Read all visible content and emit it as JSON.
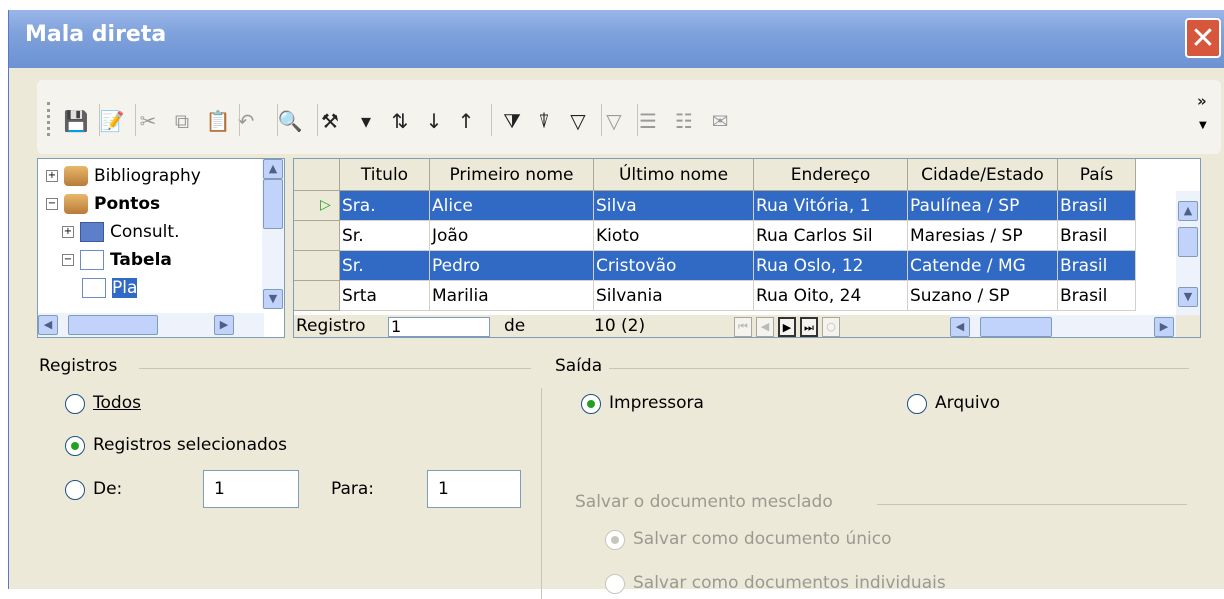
{
  "window": {
    "title": "Mala direta",
    "close_label": "✕"
  },
  "toolbar": {
    "buttons": [
      {
        "name": "save-icon",
        "glyph": "💾",
        "active": false
      },
      {
        "name": "edit-icon",
        "glyph": "📝",
        "active": false
      },
      {
        "name": "cut-icon",
        "glyph": "✂",
        "active": false
      },
      {
        "name": "copy-icon",
        "glyph": "⧉",
        "active": false
      },
      {
        "name": "paste-icon",
        "glyph": "📋",
        "active": false
      },
      {
        "name": "undo-icon",
        "glyph": "↶",
        "active": false
      },
      {
        "name": "find-icon",
        "glyph": "🔍",
        "active": true
      },
      {
        "name": "autopilot-icon",
        "glyph": "⚒",
        "active": true
      },
      {
        "name": "dropdown-arrow-icon",
        "glyph": "▾",
        "active": true
      },
      {
        "name": "sort-icon",
        "glyph": "⇅",
        "active": true
      },
      {
        "name": "sort-ascending-icon",
        "glyph": "↓",
        "active": true
      },
      {
        "name": "sort-descending-icon",
        "glyph": "↑",
        "active": true
      },
      {
        "name": "autofilter-icon",
        "glyph": "⧩",
        "active": true
      },
      {
        "name": "standard-filter-icon",
        "glyph": "⍒",
        "active": true
      },
      {
        "name": "remove-filter-icon",
        "glyph": "▽",
        "active": true
      },
      {
        "name": "data-to-text-icon",
        "glyph": "▽",
        "active": false
      },
      {
        "name": "data-to-fields-icon",
        "glyph": "☰",
        "active": false
      },
      {
        "name": "mail-merge-icon",
        "glyph": "☷",
        "active": false
      },
      {
        "name": "envelope-icon",
        "glyph": "✉",
        "active": false
      }
    ],
    "more_label": "»"
  },
  "tree": {
    "items": [
      {
        "label": "Bibliography",
        "expander": "+",
        "type": "db",
        "bold": false
      },
      {
        "label": "Pontos",
        "expander": "−",
        "type": "db",
        "bold": true
      },
      {
        "label": "Consult.",
        "expander": "+",
        "type": "query",
        "bold": false
      },
      {
        "label": "Tabela",
        "expander": "−",
        "type": "table",
        "bold": true
      },
      {
        "label": "Pla",
        "expander": "",
        "type": "table",
        "bold": false
      }
    ]
  },
  "grid": {
    "columns": [
      "Titulo",
      "Primeiro nome",
      "Último nome",
      "Endereço",
      "Cidade/Estado",
      "País"
    ],
    "rows": [
      {
        "cells": [
          "Sra.",
          "Alice",
          "Silva",
          "Rua Vitória, 1",
          "Paulínea / SP",
          "Brasil"
        ],
        "selected": true,
        "current": true
      },
      {
        "cells": [
          "Sr.",
          "João",
          "Kioto",
          "Rua Carlos Sil",
          "Maresias / SP",
          "Brasil"
        ],
        "selected": false,
        "current": false
      },
      {
        "cells": [
          "Sr.",
          "Pedro",
          "Cristovão",
          "Rua Oslo, 12",
          "Catende / MG",
          "Brasil"
        ],
        "selected": true,
        "current": false
      },
      {
        "cells": [
          "Srta",
          "Marilia",
          "Silvania",
          "Rua Oito, 24",
          "Suzano / SP",
          "Brasil"
        ],
        "selected": false,
        "current": false
      }
    ],
    "current_marker": "▷",
    "nav": {
      "record_label": "Registro",
      "record_value": "1",
      "of_label": "de",
      "count": "10 (2)"
    }
  },
  "registros": {
    "title": "Registros",
    "all_label": "Todos",
    "selected_label": "Registros selecionados",
    "from_label": "De:",
    "from_value": "1",
    "to_label": "Para:",
    "to_value": "1"
  },
  "saida": {
    "title": "Saída",
    "printer_label": "Impressora",
    "file_label": "Arquivo",
    "save_group_title": "Salvar o documento mesclado",
    "single_doc_label": "Salvar como documento único",
    "individual_docs_label": "Salvar como documentos individuais"
  }
}
